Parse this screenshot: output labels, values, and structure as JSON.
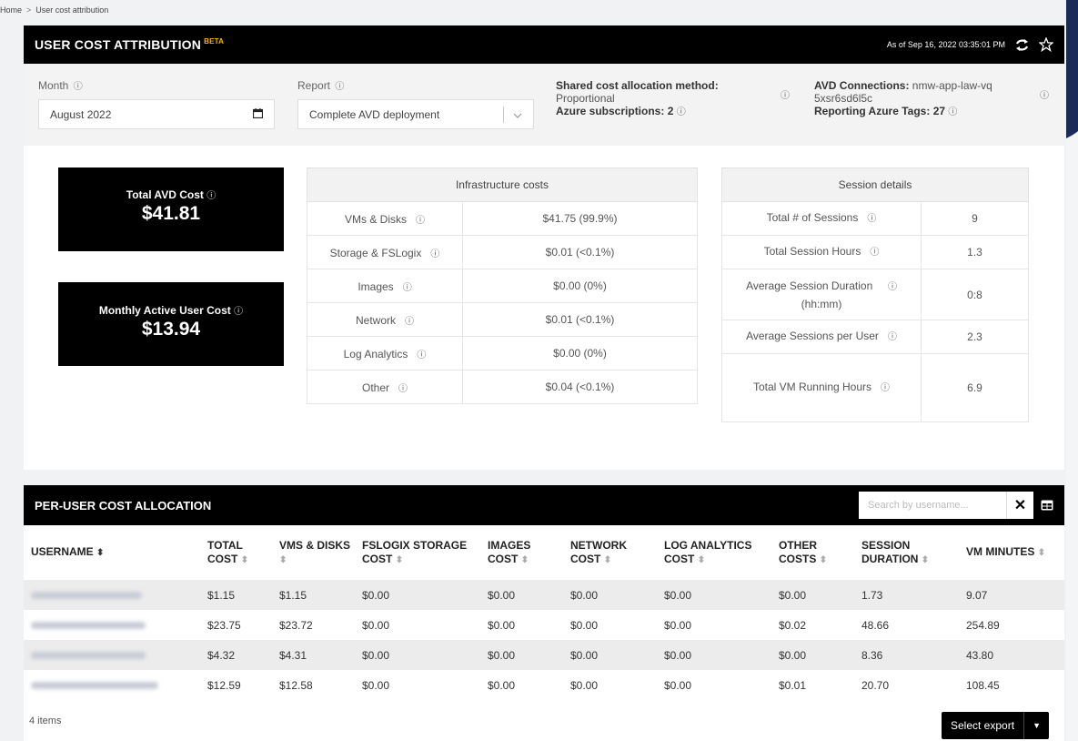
{
  "breadcrumb": {
    "home": "Home",
    "separator": ">",
    "current": "User cost attribution"
  },
  "header": {
    "title": "USER COST ATTRIBUTION",
    "badge": "BETA",
    "as_of": "As of Sep 16, 2022 03:35:01 PM",
    "refresh_icon": "refresh-icon",
    "favorite_icon": "star-icon"
  },
  "filters": {
    "month_label": "Month",
    "month_value": "August 2022",
    "report_label": "Report",
    "report_value": "Complete AVD deployment",
    "shared_cost_label": "Shared cost allocation method:",
    "shared_cost_value": "Proportional",
    "azure_subs_label": "Azure subscriptions:",
    "azure_subs_value": "2",
    "avd_conn_label": "AVD Connections:",
    "avd_conn_value": "nmw-app-law-vq5xsr6sd6l5c",
    "tags_label": "Reporting Azure Tags:",
    "tags_value": "27",
    "info_glyph": "ⓘ"
  },
  "kpis": {
    "total_avd_label": "Total AVD Cost",
    "total_avd_value": "$41.81",
    "mau_label": "Monthly Active User Cost",
    "mau_value": "$13.94"
  },
  "infrastructure": {
    "title": "Infrastructure costs",
    "rows": [
      {
        "label": "VMs & Disks",
        "value": "$41.75 (99.9%)"
      },
      {
        "label": "Storage & FSLogix",
        "value": "$0.01 (<0.1%)"
      },
      {
        "label": "Images",
        "value": "$0.00 (0%)"
      },
      {
        "label": "Network",
        "value": "$0.01 (<0.1%)"
      },
      {
        "label": "Log Analytics",
        "value": "$0.00 (0%)"
      },
      {
        "label": "Other",
        "value": "$0.04 (<0.1%)"
      }
    ]
  },
  "sessions": {
    "title": "Session details",
    "rows": [
      {
        "label": "Total # of Sessions",
        "value": "9"
      },
      {
        "label": "Total Session Hours",
        "value": "1.3"
      },
      {
        "label": "Average Session Duration",
        "label2": "(hh:mm)",
        "value": "0:8"
      },
      {
        "label": "Average Sessions per User",
        "value": "2.3"
      },
      {
        "label": "Total VM Running Hours",
        "value": "6.9"
      }
    ]
  },
  "allocation": {
    "title": "PER-USER COST ALLOCATION",
    "search_placeholder": "Search by username...",
    "columns": [
      [
        "USERNAME",
        ""
      ],
      [
        "TOTAL",
        "COST"
      ],
      [
        "VMS & DISKS",
        ""
      ],
      [
        "FSLOGIX STORAGE",
        "COST"
      ],
      [
        "IMAGES",
        "COST"
      ],
      [
        "NETWORK",
        "COST"
      ],
      [
        "LOG ANALYTICS",
        "COST"
      ],
      [
        "OTHER",
        "COSTS"
      ],
      [
        "SESSION",
        "DURATION"
      ],
      [
        "VM MINUTES",
        ""
      ]
    ],
    "rows": [
      [
        "",
        "$1.15",
        "$1.15",
        "$0.00",
        "$0.00",
        "$0.00",
        "$0.00",
        "$0.00",
        "1.73",
        "9.07"
      ],
      [
        "",
        "$23.75",
        "$23.72",
        "$0.00",
        "$0.00",
        "$0.00",
        "$0.00",
        "$0.02",
        "48.66",
        "254.89"
      ],
      [
        "",
        "$4.32",
        "$4.31",
        "$0.00",
        "$0.00",
        "$0.00",
        "$0.00",
        "$0.00",
        "8.36",
        "43.80"
      ],
      [
        "",
        "$12.59",
        "$12.58",
        "$0.00",
        "$0.00",
        "$0.00",
        "$0.00",
        "$0.01",
        "20.70",
        "108.45"
      ]
    ],
    "item_count": "4 items",
    "export_label": "Select export"
  }
}
